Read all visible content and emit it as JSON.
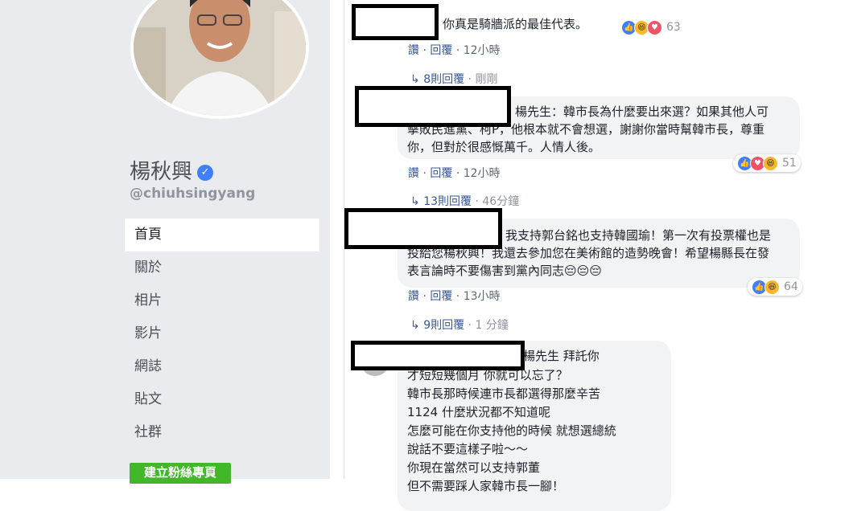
{
  "profile": {
    "name": "楊秋興",
    "handle": "@chiuhsingyang"
  },
  "nav": [
    "首頁",
    "關於",
    "相片",
    "影片",
    "網誌",
    "貼文",
    "社群"
  ],
  "create_button": "建立粉絲專頁",
  "comments": [
    {
      "text": "你真是騎牆派的最佳代表。",
      "reactions": [
        "like",
        "haha",
        "love"
      ],
      "reaction_count": "63",
      "actions": {
        "like": "讚",
        "reply": "回覆",
        "time": "12小時"
      },
      "replies": {
        "label": "8則回覆",
        "time": "剛剛"
      }
    },
    {
      "text": "楊先生：韓市長為什麼要出來選？如果其他人可擊敗民進黨、柯P，他根本就不會想選，謝謝你當時幫韓市長，尊重你，但對於很感慨萬千。人情人後。",
      "reactions": [
        "like",
        "love",
        "haha"
      ],
      "reaction_count": "51",
      "actions": {
        "like": "讚",
        "reply": "回覆",
        "time": "12小時"
      },
      "replies": {
        "label": "13則回覆",
        "time": "46分鐘"
      }
    },
    {
      "text": "我支持郭台銘也支持韓國瑜！第一次有投票權也是投給您楊秋興！我還去參加您在美術館的造勢晚會！希望楊縣長在發表言論時不要傷害到黨內同志😔😔😔",
      "reactions": [
        "like",
        "haha"
      ],
      "reaction_count": "64",
      "actions": {
        "like": "讚",
        "reply": "回覆",
        "time": "13小時"
      },
      "replies": {
        "label": "9則回覆",
        "time": "1 分鐘"
      }
    },
    {
      "lines": [
        "楊先生 拜託你",
        "才短短幾個月 你就可以忘了？",
        "韓市長那時候連市長都選得那麼辛苦",
        "1124 什麼狀況都不知道呢",
        "怎麼可能在你支持他的時候 就想選總統",
        "說話不要這樣子啦～～",
        "你現在當然可以支持郭董",
        "但不需要踩人家韓市長一腳！"
      ]
    }
  ]
}
